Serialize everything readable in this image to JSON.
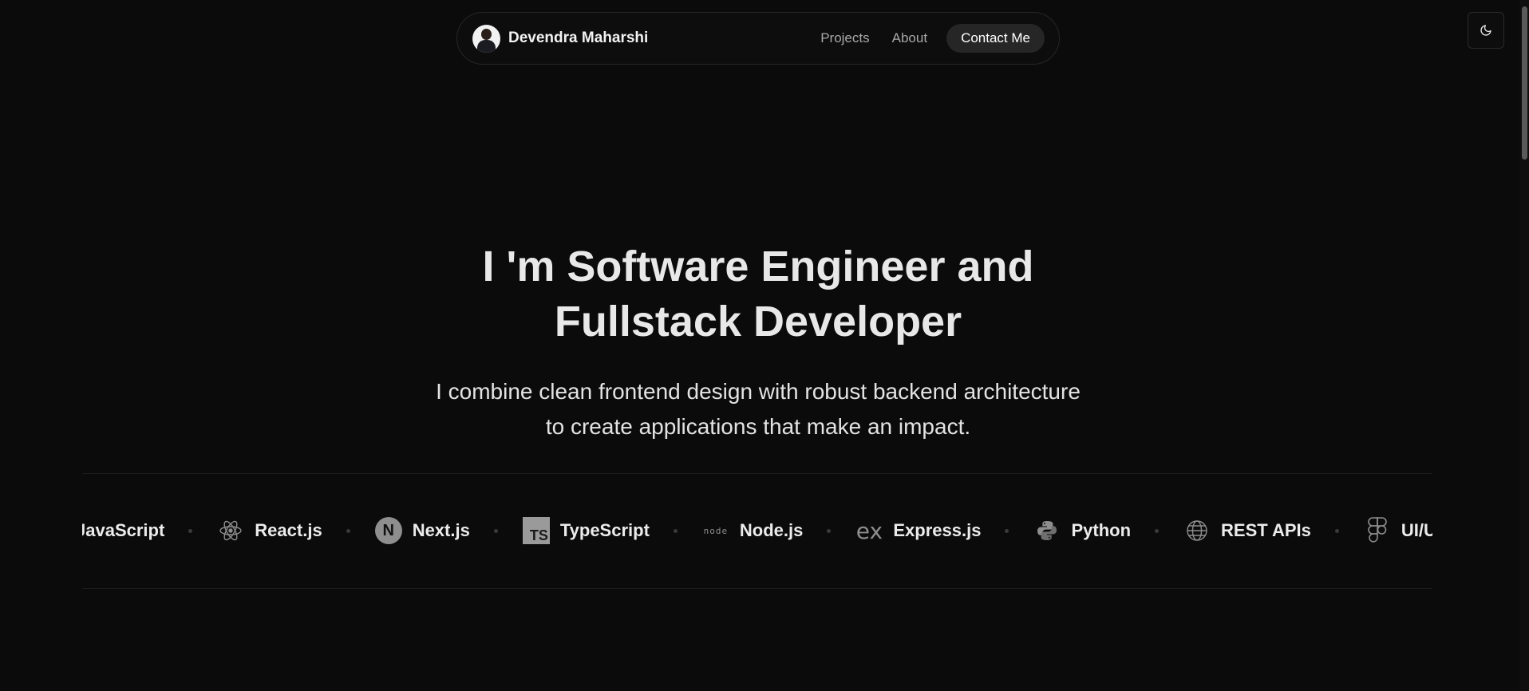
{
  "nav": {
    "brand_name": "Devendra Maharshi",
    "links": [
      "Projects",
      "About"
    ],
    "cta_label": "Contact Me"
  },
  "theme_toggle": {
    "icon": "moon-icon"
  },
  "hero": {
    "title_line1": "I 'm Software Engineer and",
    "title_line2": "Fullstack Developer",
    "subtitle_line1": "I combine clean frontend design with robust backend architecture",
    "subtitle_line2": "to create applications that make an impact."
  },
  "tech_stack": [
    {
      "name": "JavaScript",
      "icon": "javascript-icon"
    },
    {
      "name": "React.js",
      "icon": "react-icon"
    },
    {
      "name": "Next.js",
      "icon": "nextjs-icon"
    },
    {
      "name": "TypeScript",
      "icon": "typescript-icon"
    },
    {
      "name": "Node.js",
      "icon": "nodejs-icon"
    },
    {
      "name": "Express.js",
      "icon": "express-icon"
    },
    {
      "name": "Python",
      "icon": "python-icon"
    },
    {
      "name": "REST APIs",
      "icon": "globe-icon"
    },
    {
      "name": "UI/UX",
      "icon": "figma-icon"
    }
  ],
  "colors": {
    "background": "#0b0b0b",
    "text": "#e8e8e8",
    "muted": "#a8a8a8",
    "button": "#262626"
  }
}
